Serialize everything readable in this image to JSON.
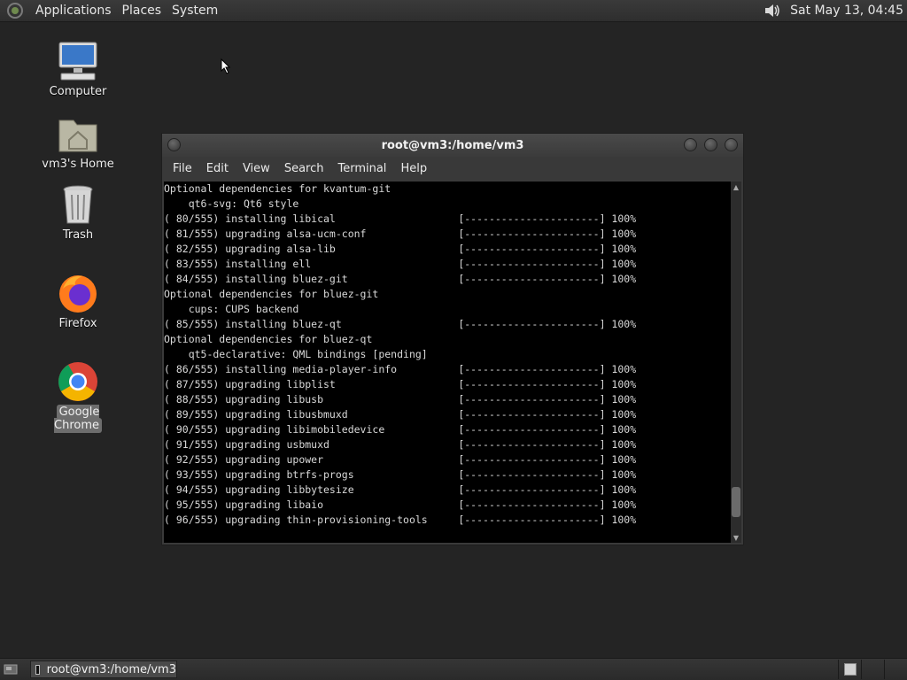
{
  "top_panel": {
    "menus": [
      "Applications",
      "Places",
      "System"
    ],
    "clock": "Sat May 13, 04:45",
    "icons": {
      "logo": "gnome-foot-icon",
      "volume": "volume-icon"
    }
  },
  "desktop": {
    "icons": [
      {
        "label": "Computer",
        "icon": "computer-icon"
      },
      {
        "label": "vm3's Home",
        "icon": "home-folder-icon"
      },
      {
        "label": "Trash",
        "icon": "trash-icon"
      },
      {
        "label": "Firefox",
        "icon": "firefox-icon"
      },
      {
        "label": "Google Chrome",
        "icon": "chrome-icon",
        "selected": true
      }
    ]
  },
  "terminal": {
    "title": "root@vm3:/home/vm3",
    "menu": [
      "File",
      "Edit",
      "View",
      "Search",
      "Terminal",
      "Help"
    ],
    "lines": [
      "Optional dependencies for kvantum-git",
      "    qt6-svg: Qt6 style",
      "( 80/555) installing libical                    [----------------------] 100%",
      "( 81/555) upgrading alsa-ucm-conf               [----------------------] 100%",
      "( 82/555) upgrading alsa-lib                    [----------------------] 100%",
      "( 83/555) installing ell                        [----------------------] 100%",
      "( 84/555) installing bluez-git                  [----------------------] 100%",
      "Optional dependencies for bluez-git",
      "    cups: CUPS backend",
      "( 85/555) installing bluez-qt                   [----------------------] 100%",
      "Optional dependencies for bluez-qt",
      "    qt5-declarative: QML bindings [pending]",
      "( 86/555) installing media-player-info          [----------------------] 100%",
      "( 87/555) upgrading libplist                    [----------------------] 100%",
      "( 88/555) upgrading libusb                      [----------------------] 100%",
      "( 89/555) upgrading libusbmuxd                  [----------------------] 100%",
      "( 90/555) upgrading libimobiledevice            [----------------------] 100%",
      "( 91/555) upgrading usbmuxd                     [----------------------] 100%",
      "( 92/555) upgrading upower                      [----------------------] 100%",
      "( 93/555) upgrading btrfs-progs                 [----------------------] 100%",
      "( 94/555) upgrading libbytesize                 [----------------------] 100%",
      "( 95/555) upgrading libaio                      [----------------------] 100%",
      "( 96/555) upgrading thin-provisioning-tools     [----------------------] 100%"
    ],
    "scroll_position": 0.95
  },
  "bottom_panel": {
    "task_label": "root@vm3:/home/vm3",
    "icons": {
      "show_desktop": "show-desktop-icon",
      "task": "terminal-icon"
    }
  }
}
